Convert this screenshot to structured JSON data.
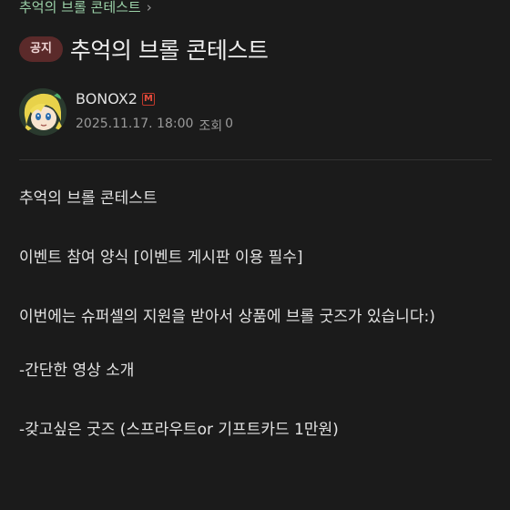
{
  "breadcrumb": {
    "label": "추억의 브롤 콘테스트"
  },
  "header": {
    "badge": "공지",
    "title": "추억의 브롤 콘테스트"
  },
  "author": {
    "name": "BONOX2",
    "badge": "M",
    "date": "2025.11.17. 18:00",
    "views_label": "조회",
    "views": "0"
  },
  "content": {
    "lines": [
      "추억의 브롤 콘테스트",
      "이벤트 참여 양식 [이벤트 게시판 이용 필수]",
      "이번에는 슈퍼셀의 지원을 받아서 상품에 브롤 굿즈가 있습니다:)",
      "-간단한 영상 소개",
      "-갖고싶은 굿즈 (스프라우트or 기프트카드 1만원)"
    ]
  },
  "colors": {
    "background": "#1b1b1b",
    "breadcrumb": "#9bd1a8",
    "badge_bg": "#5b2a2a",
    "manager_badge": "#e74c3c"
  },
  "icons": [
    "chevron-right-icon",
    "manager-badge-icon",
    "avatar"
  ]
}
